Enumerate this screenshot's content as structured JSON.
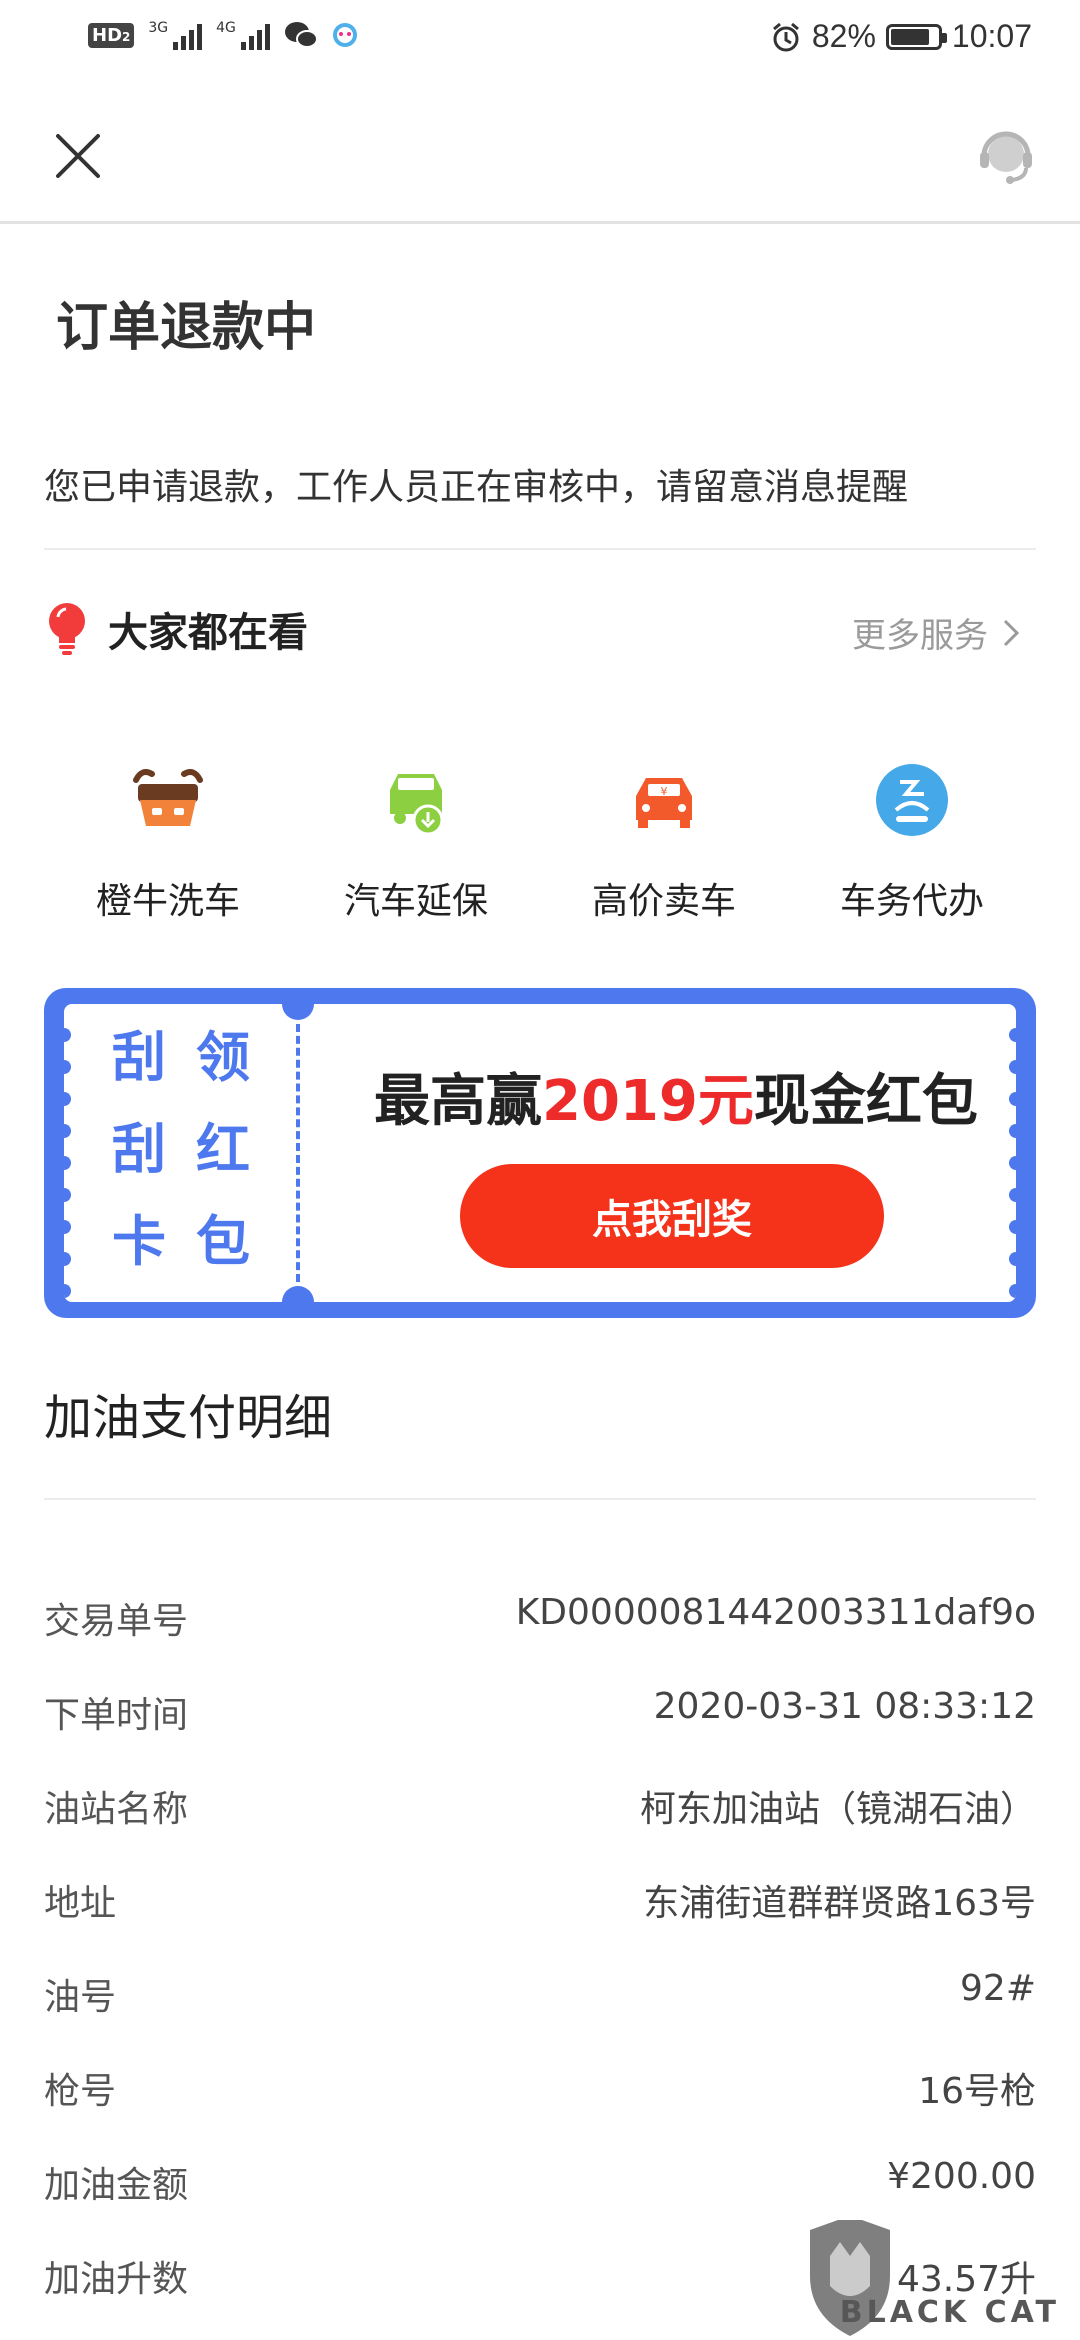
{
  "status_bar": {
    "hd": "HD",
    "hd_sub": "2",
    "net1": "3G",
    "net2": "4G",
    "battery_percent": "82%",
    "battery_level": 0.82,
    "time": "10:07"
  },
  "page": {
    "title": "订单退款中",
    "description": "您已申请退款，工作人员正在审核中，请留意消息提醒"
  },
  "popular": {
    "title": "大家都在看",
    "more_label": "更多服务",
    "services": [
      {
        "label": "橙牛洗车",
        "icon": "ox-car-icon"
      },
      {
        "label": "汽车延保",
        "icon": "car-warranty-icon"
      },
      {
        "label": "高价卖车",
        "icon": "sell-car-icon"
      },
      {
        "label": "车务代办",
        "icon": "car-service-icon"
      }
    ]
  },
  "banner": {
    "left_chars": [
      "刮",
      "领",
      "刮",
      "红",
      "卡",
      "包"
    ],
    "promo_prefix": "最高赢",
    "promo_amount": "2019元",
    "promo_suffix": "现金红包",
    "button_label": "点我刮奖"
  },
  "payment": {
    "section_title": "加油支付明细",
    "rows": [
      {
        "key": "交易单号",
        "value": "KD0000081442003311daf9o"
      },
      {
        "key": "下单时间",
        "value": "2020-03-31 08:33:12"
      },
      {
        "key": "油站名称",
        "value": "柯东加油站（镜湖石油）"
      },
      {
        "key": "地址",
        "value": "东浦街道群群贤路163号"
      },
      {
        "key": "油号",
        "value": "92#"
      },
      {
        "key": "枪号",
        "value": "16号枪"
      },
      {
        "key": "加油金额",
        "value": "¥200.00"
      },
      {
        "key": "加油升数",
        "value": "43.57升"
      }
    ]
  },
  "watermark": {
    "text": "BLACK CAT"
  },
  "colors": {
    "accent_blue": "#4e79ee",
    "accent_red": "#f5321a",
    "highlight_red": "#ee2b2b"
  }
}
